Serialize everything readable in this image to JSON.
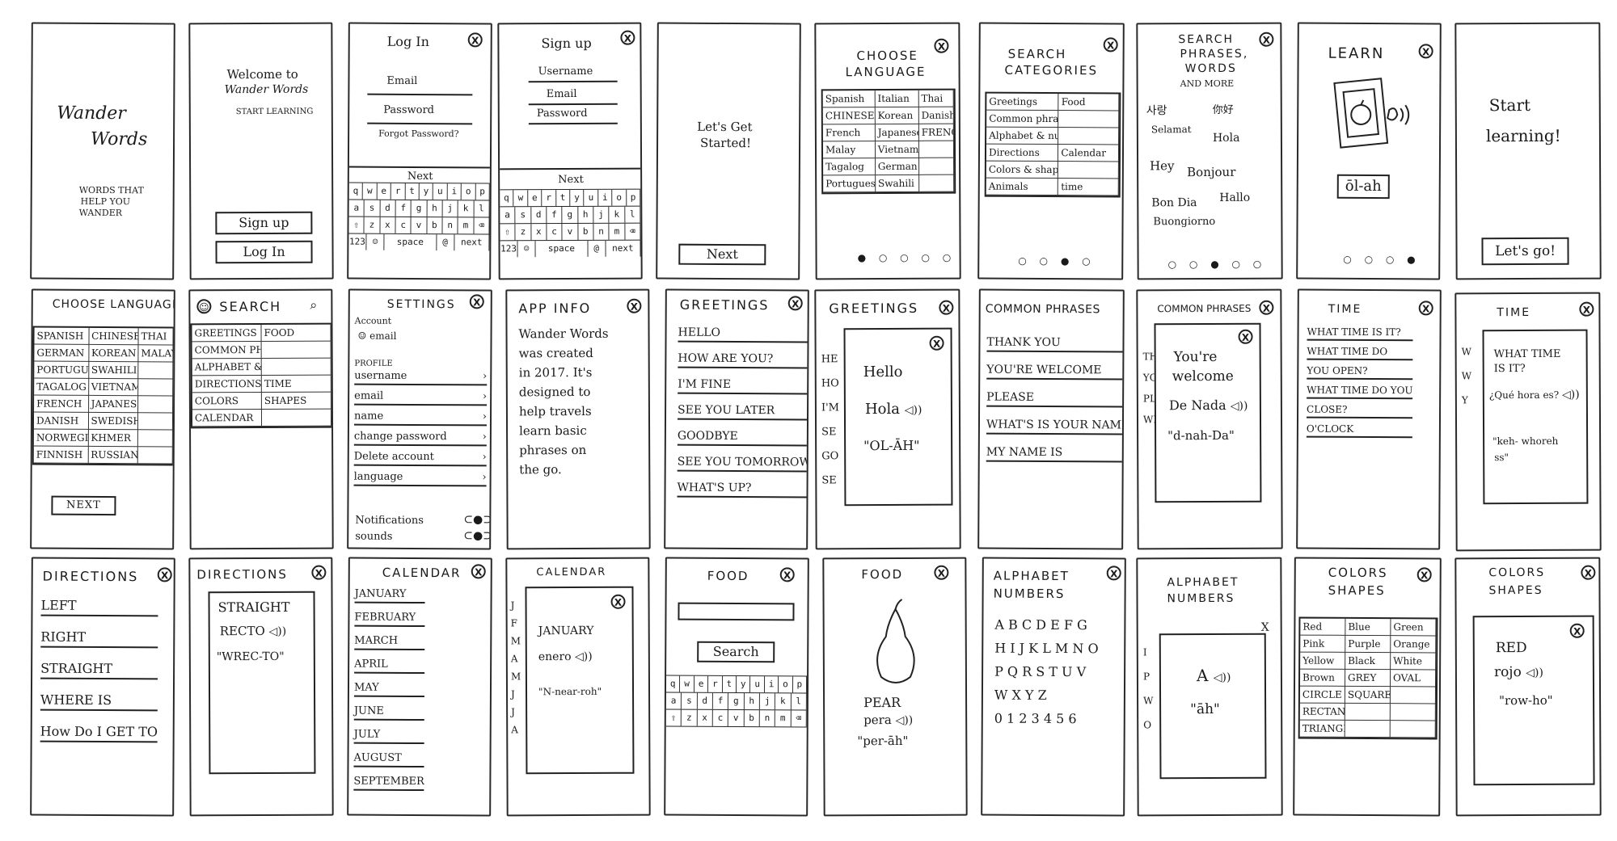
{
  "row1": {
    "splash": {
      "title_line1": "Wander",
      "title_line2": "Words",
      "tagline_line1": "WORDS THAT",
      "tagline_line2": "HELP YOU",
      "tagline_line3": "WANDER"
    },
    "welcome": {
      "line1": "Welcome to",
      "line2": "Wander Words",
      "sub": "START LEARNING",
      "signup": "Sign up",
      "login": "Log In"
    },
    "login": {
      "title": "Log In",
      "close": "X",
      "email": "Email",
      "password": "Password",
      "forgot": "Forgot Password?",
      "next": "Next"
    },
    "signup": {
      "title": "Sign up",
      "close": "X",
      "username": "Username",
      "email": "Email",
      "password": "Password",
      "next": "Next"
    },
    "started": {
      "line1": "Let's Get",
      "line2": "Started!",
      "next": "Next"
    },
    "choose_lang": {
      "title_line1": "CHOOSE",
      "title_line2": "LANGUAGE",
      "close": "X",
      "cells": [
        "Spanish",
        "Italian",
        "Thai",
        "CHINESE",
        "Korean",
        "Danish",
        "French",
        "Japanese",
        "FRENCH",
        "Malay",
        "Vietnamese",
        "",
        "Tagalog",
        "German",
        "",
        "Portuguese",
        "Swahili",
        ""
      ],
      "dots": "● ○ ○ ○ ○"
    },
    "search_cat": {
      "title_line1": "SEARCH",
      "title_line2": "CATEGORIES",
      "close": "X",
      "cells": [
        "Greetings",
        "Food",
        "Common phrases",
        "",
        "Alphabet & numbers",
        "",
        "Directions",
        "Calendar",
        "Colors & shapes",
        "",
        "Animals",
        "time"
      ],
      "dots": "○ ○ ● ○"
    },
    "search_phrases": {
      "title_line1": "SEARCH",
      "title_line2": "PHRASES,",
      "title_line3": "WORDS",
      "title_line4": "AND MORE",
      "close": "X",
      "w1": "사랑",
      "w2": "你好",
      "w3": "Selamat",
      "w4": "Hola",
      "w5": "Hey",
      "w6": "Bonjour",
      "w7": "Bon Dia",
      "w8": "Hallo",
      "w9": "Buongiorno",
      "dots": "○ ○ ● ○ ○"
    },
    "learn": {
      "title": "LEARN",
      "close": "X",
      "word": "ōl-ah",
      "dots": "○ ○ ○ ●"
    },
    "start_learning": {
      "line1": "Start",
      "line2": "learning!",
      "btn": "Let's go!"
    }
  },
  "row2": {
    "choose_lang2": {
      "title": "CHOOSE LANGUAGE",
      "cells": [
        "SPANISH",
        "CHINESE",
        "THAI",
        "GERMAN",
        "KOREAN",
        "MALAY",
        "PORTUGUESE",
        "SWAHILI",
        "",
        "TAGALOG",
        "VIETNAMESE",
        "",
        "FRENCH",
        "JAPANESE",
        "",
        "DANISH",
        "SWEDISH",
        "",
        "NORWEGIAN",
        "KHMER",
        "",
        "FINNISH",
        "RUSSIAN",
        ""
      ],
      "next": "NEXT"
    },
    "search": {
      "title": "SEARCH",
      "cells": [
        "GREETINGS",
        "FOOD",
        "COMMON PHRASES",
        "",
        "ALPHABET & NUMBERS",
        "",
        "DIRECTIONS",
        "TIME",
        "COLORS",
        "SHAPES",
        "CALENDAR",
        ""
      ]
    },
    "settings": {
      "title": "SETTINGS",
      "close": "X",
      "account": "Account",
      "email_item": "email",
      "profile": "PROFILE",
      "items": [
        "username",
        "email",
        "name",
        "change password",
        "Delete account",
        "language"
      ],
      "notif": "Notifications",
      "sounds": "sounds"
    },
    "app_info": {
      "title": "APP INFO",
      "close": "X",
      "lines": [
        "Wander Words",
        "was created",
        "in 2017. It's",
        "designed to",
        "help travels",
        "learn basic",
        "phrases on",
        "the go."
      ]
    },
    "greetings": {
      "title": "GREETINGS",
      "close": "X",
      "items": [
        "HELLO",
        "HOW ARE YOU?",
        "I'M FINE",
        "SEE YOU LATER",
        "GOODBYE",
        "SEE YOU TOMORROW",
        "WHAT'S UP?"
      ]
    },
    "greetings_pop": {
      "title": "GREETINGS",
      "close": "X",
      "en": "Hello",
      "tr": "Hola",
      "pr": "\"OL-ĀH\""
    },
    "common": {
      "title": "COMMON PHRASES",
      "items": [
        "THANK YOU",
        "YOU'RE WELCOME",
        "PLEASE",
        "WHAT'S IS YOUR NAME",
        "MY NAME IS"
      ]
    },
    "common_pop": {
      "title": "COMMON PHRASES",
      "close": "X",
      "en1": "You're",
      "en2": "welcome",
      "tr": "De Nada",
      "pr": "\"d-nah-Da\""
    },
    "time": {
      "title": "TIME",
      "close": "X",
      "items": [
        "WHAT TIME IS IT?",
        "WHAT TIME DO",
        "YOU OPEN?",
        "WHAT TIME DO YOU",
        "CLOSE?",
        "O'CLOCK"
      ]
    },
    "time_pop": {
      "title": "TIME",
      "close": "X",
      "en1": "WHAT TIME",
      "en2": "IS IT?",
      "tr": "¿Qué hora es?",
      "pr1": "\"keh- whoreh",
      "pr2": "ss\""
    }
  },
  "row3": {
    "directions": {
      "title": "DIRECTIONS",
      "close": "X",
      "items": [
        "LEFT",
        "RIGHT",
        "STRAIGHT",
        "WHERE IS",
        "How Do I GET TO"
      ]
    },
    "directions_pop": {
      "title": "DIRECTIONS",
      "close": "X",
      "en": "STRAIGHT",
      "tr": "RECTO",
      "pr": "\"WREC-TO\""
    },
    "calendar": {
      "title": "CALENDAR",
      "close": "X",
      "items": [
        "JANUARY",
        "FEBRUARY",
        "MARCH",
        "APRIL",
        "MAY",
        "JUNE",
        "JULY",
        "AUGUST",
        "SEPTEMBER"
      ]
    },
    "calendar_pop": {
      "title": "CALENDAR",
      "close": "X",
      "en": "JANUARY",
      "tr": "enero",
      "pr": "\"N-near-roh\""
    },
    "food": {
      "title": "FOOD",
      "close": "X",
      "search": "Search"
    },
    "food_pop": {
      "title": "FOOD",
      "close": "X",
      "en": "PEAR",
      "tr": "pera",
      "pr": "\"per-āh\""
    },
    "alphabet": {
      "title_line1": "ALPHABET",
      "title_line2": "NUMBERS",
      "close": "X",
      "lines": [
        "A B C D E F G",
        "H I J K L M N O",
        "P Q R S T U V",
        "W X Y Z",
        "0 1 2 3 4 5 6"
      ]
    },
    "alphabet_pop": {
      "title_line1": "ALPHABET",
      "title_line2": "NUMBERS",
      "close": "X",
      "en": "A",
      "pr": "\"āh\""
    },
    "colors": {
      "title_line1": "COLORS",
      "title_line2": "SHAPES",
      "close": "X",
      "cells": [
        "Red",
        "Blue",
        "Green",
        "Pink",
        "Purple",
        "Orange",
        "Yellow",
        "Black",
        "White",
        "Brown",
        "GREY",
        "OVAL",
        "CIRCLE",
        "SQUARE",
        "",
        "RECTANGLE",
        "",
        "",
        "TRIANGLE",
        "",
        ""
      ]
    },
    "colors_pop": {
      "title_line1": "COLORS",
      "title_line2": "SHAPES",
      "close": "X",
      "en": "RED",
      "tr": "rojo",
      "pr": "\"row-ho\""
    }
  },
  "keyboard": {
    "row1": [
      "q",
      "w",
      "e",
      "r",
      "t",
      "y",
      "u",
      "i",
      "o",
      "p"
    ],
    "row2": [
      "a",
      "s",
      "d",
      "f",
      "g",
      "h",
      "j",
      "k",
      "l"
    ],
    "row3": [
      "⇧",
      "z",
      "x",
      "c",
      "v",
      "b",
      "n",
      "m",
      "⌫"
    ],
    "row4": [
      "123",
      "☺",
      "space",
      "@",
      "next"
    ]
  }
}
